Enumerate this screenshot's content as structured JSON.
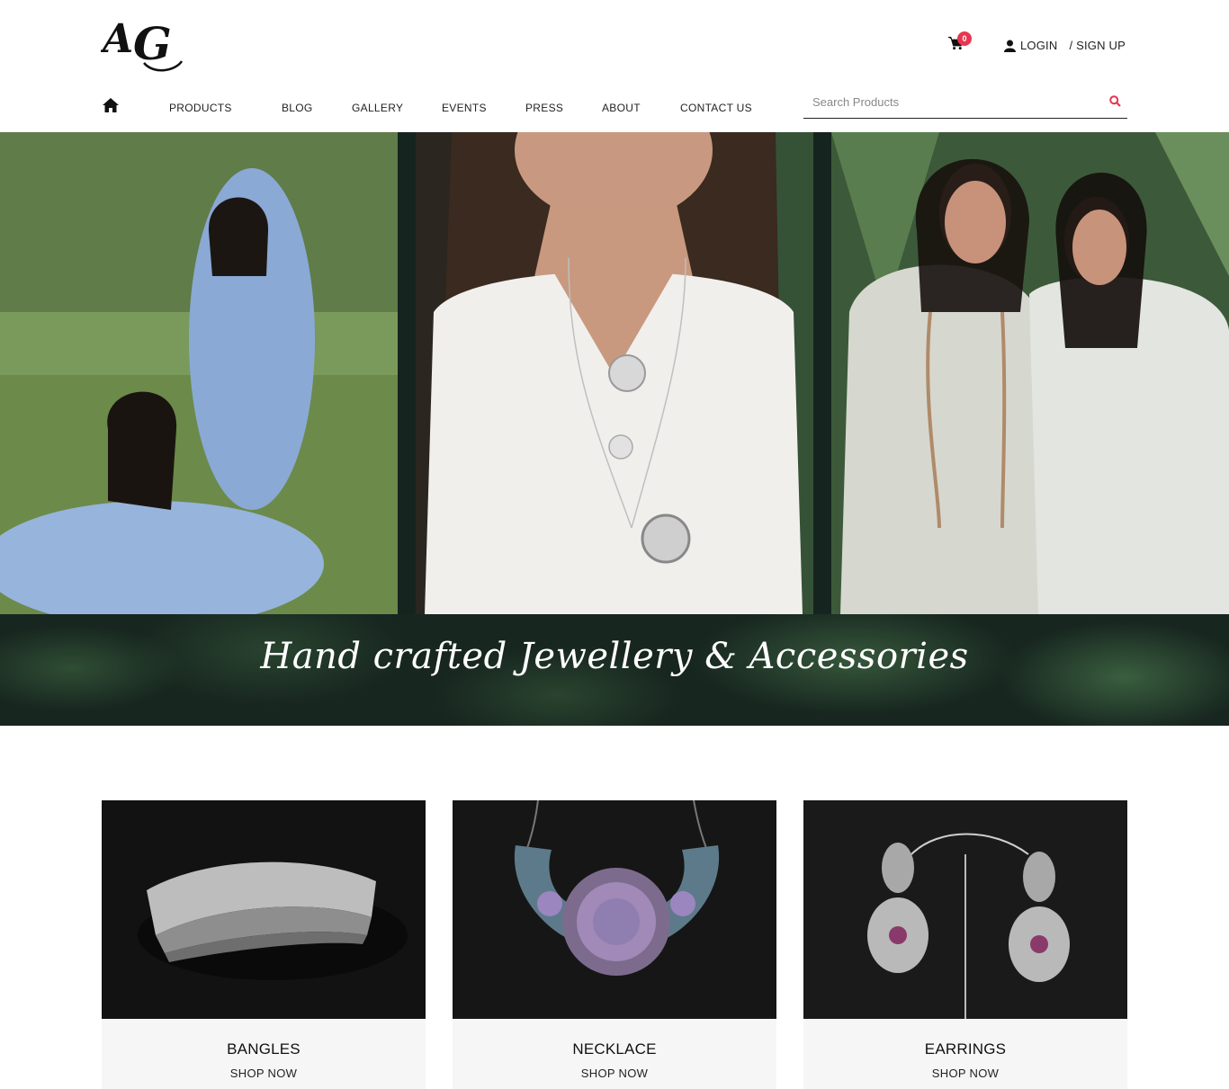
{
  "brand": {
    "logo_text": "AG"
  },
  "header": {
    "cart_count": "0",
    "login_label": "LOGIN",
    "signup_label": "/ SIGN UP"
  },
  "nav": {
    "items": [
      "PRODUCTS",
      "BLOG",
      "GALLERY",
      "EVENTS",
      "PRESS",
      "ABOUT",
      "CONTACT US"
    ]
  },
  "search": {
    "placeholder": "Search Products",
    "value": ""
  },
  "hero": {
    "tagline": "Hand crafted Jewellery & Accessories"
  },
  "categories": [
    {
      "title": "BANGLES",
      "link": "SHOP NOW"
    },
    {
      "title": "NECKLACE",
      "link": "SHOP NOW"
    },
    {
      "title": "EARRINGS",
      "link": "SHOP NOW"
    }
  ],
  "colors": {
    "accent": "#e8354f",
    "text": "#222222",
    "hero_dark": "#16241f",
    "card_footer": "#f6f6f6"
  },
  "icons": {
    "cart": "cart-icon",
    "user": "user-icon",
    "home": "home-icon",
    "search": "search-icon"
  }
}
